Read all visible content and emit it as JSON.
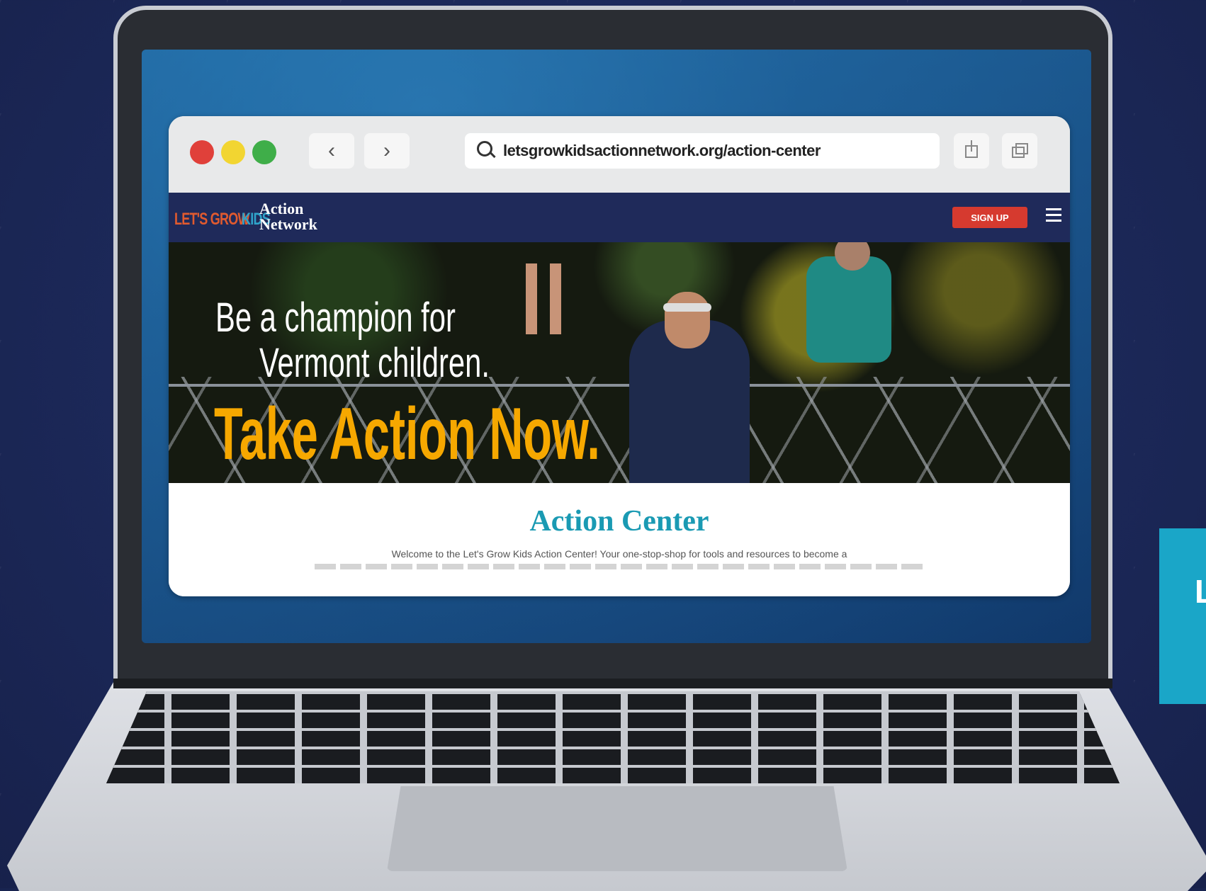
{
  "browser": {
    "url": "letsgrowkidsactionnetwork.org/action-center",
    "traffic_light_colors": [
      "#e0403a",
      "#f2d531",
      "#3fae49"
    ],
    "icons": {
      "back": "chevron-left-icon",
      "forward": "chevron-right-icon",
      "search": "search-icon",
      "share": "share-icon",
      "tabs": "tabs-icon"
    }
  },
  "site": {
    "logo_lets_grow": "LET'S GROW",
    "logo_kids": "KIDS",
    "logo_action": "Action",
    "logo_network": "Network",
    "signup_label": "SIGN UP",
    "menu_icon": "hamburger-menu-icon",
    "header_color": "#1f2a5a",
    "signup_color": "#d63a2f"
  },
  "hero": {
    "line1": "Be a champion for",
    "line2": "Vermont children.",
    "cta": "Take Action Now.",
    "cta_color": "#f6a800"
  },
  "content": {
    "title": "Action Center",
    "intro": "Welcome to the Let's Grow Kids Action Center! Your one-stop-shop for tools and resources to become a",
    "title_color": "#1a9ab3"
  },
  "side_card": {
    "letter": "L",
    "color": "#1aa6c8"
  }
}
